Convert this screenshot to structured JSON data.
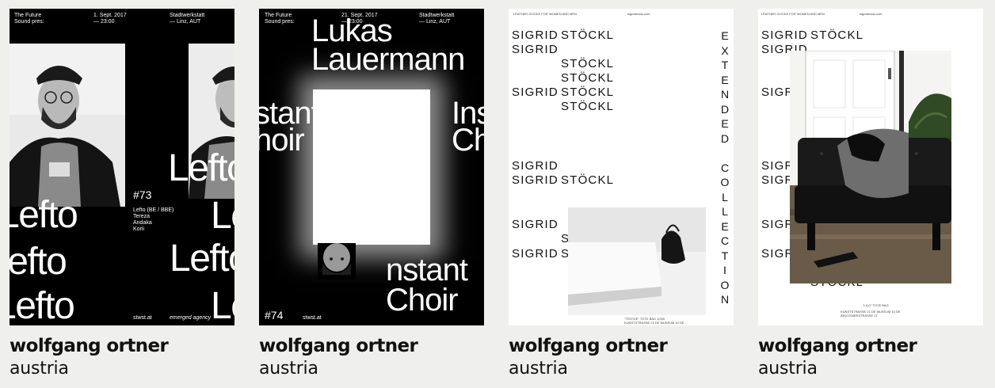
{
  "cards": [
    {
      "designer": "wolfgang ortner",
      "country": "austria",
      "poster": {
        "header_left": "The Future\nSound pres:",
        "header_mid": "1. Sept. 2017\n— 23:00",
        "header_right": "Stadtwerkstatt\n— Linz, AUT",
        "number": "#73",
        "lineup": "Lefto (BE / BBE)\nTereza\nAndaka\nKorii",
        "big_word": "Lefto",
        "footer_left": "stwst.at",
        "footer_right": "emerged agency"
      }
    },
    {
      "designer": "wolfgang ortner",
      "country": "austria",
      "poster": {
        "header_left": "The Future\nSound pres:",
        "header_mid": "21. Sept. 2017\n— 23:00",
        "header_right": "Stadtwerkstatt\n— Linz, AUT",
        "title_line1": "Lukas",
        "title_line2": "Lauermann",
        "left_frag_1": "stant",
        "left_frag_2": "hoir",
        "right_frag_1": "Inst",
        "right_frag_2": "Ch",
        "bottom_line1": "nstant",
        "bottom_line2": "Choir",
        "number": "#74",
        "footer": "stwst.at"
      }
    },
    {
      "designer": "wolfgang ortner",
      "country": "austria",
      "poster": {
        "header_left": "LEATHER GOODS FOR WOMEN AND MEN",
        "header_mid": "sigridstockl.com",
        "word1": "SIGRID",
        "word2": "STÖCKL",
        "vertical_1": "EXTENDED",
        "vertical_2": "COLLECTION",
        "footer": "\"TROTZE\" TOTE BAG 1/000\nKUNSTSTRASSE 21 DE MUSEUM 10 DE\nBRUCKNERSTRASSE 21"
      }
    },
    {
      "designer": "wolfgang ortner",
      "country": "austria",
      "poster": {
        "header_left": "LEATHER GOODS FOR WOMEN AND MEN",
        "header_mid": "sigridstockl.com",
        "word1": "SIGRID",
        "word2": "STÖCKL",
        "caption": "\"LILO\" TOTE BAG",
        "footer": "KUNSTSTRASSE 21 DE MUSEUM 10 DE\nBRUCKNERSTRASSE 21"
      }
    }
  ]
}
